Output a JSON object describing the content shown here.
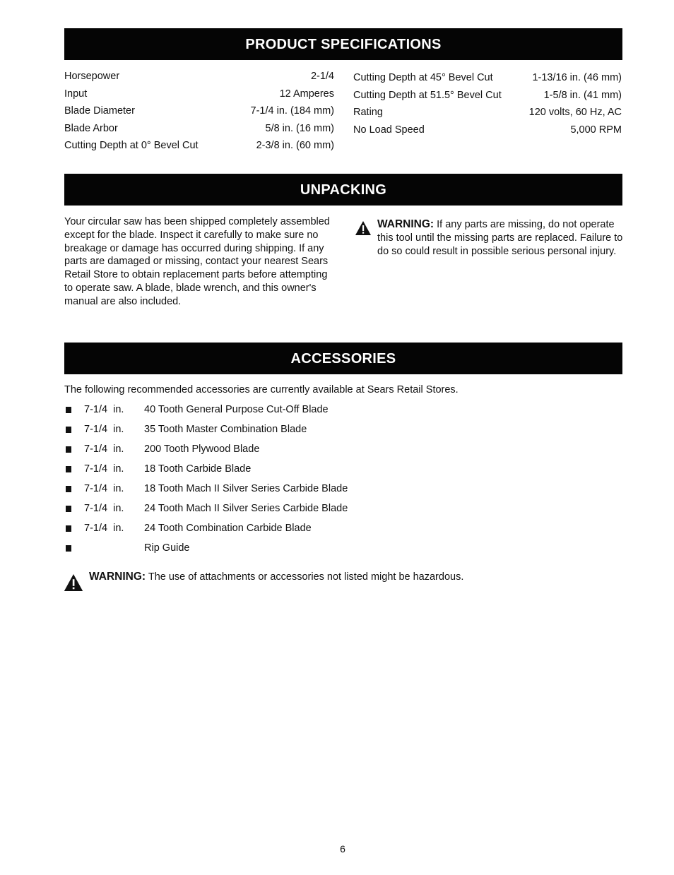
{
  "sections": {
    "specs_title": "PRODUCT SPECIFICATIONS",
    "unpacking_title": "UNPACKING",
    "accessories_title": "ACCESSORIES"
  },
  "specs": {
    "left": [
      {
        "label": "Horsepower",
        "value": "2-1/4"
      },
      {
        "label": "Input",
        "value": "12 Amperes"
      },
      {
        "label": "Blade Diameter",
        "value": "7-1/4  in. (184 mm)"
      },
      {
        "label": "Blade Arbor",
        "value": "5/8 in. (16 mm)"
      },
      {
        "label": "Cutting Depth at 0° Bevel Cut",
        "value": "2-3/8 in. (60 mm)"
      }
    ],
    "right": [
      {
        "label": "Cutting Depth at 45° Bevel Cut",
        "value": "1-13/16 in. (46 mm)"
      },
      {
        "label": "Cutting Depth at 51.5° Bevel Cut",
        "value": "1-5/8 in. (41 mm)"
      },
      {
        "label": "Rating",
        "value": "120 volts, 60 Hz, AC"
      },
      {
        "label": "No Load Speed",
        "value": "5,000 RPM"
      }
    ]
  },
  "unpacking": {
    "text": "Your circular saw has been shipped completely assembled except for the blade. Inspect it carefully to make sure no breakage or damage has occurred during shipping. If any parts are damaged or missing, contact your nearest Sears Retail Store to obtain replacement parts before attempting to operate saw. A blade, blade wrench, and this owner's manual are also included.",
    "warning_label": "WARNING:",
    "warning_text": " If any parts are missing, do not operate this tool until the missing parts are replaced. Failure to do so could result in possible serious personal injury."
  },
  "accessories": {
    "intro": "The following recommended accessories are currently available at Sears Retail Stores.",
    "items": [
      {
        "size": "7-1/4  in.",
        "name": "40 Tooth General Purpose Cut-Off Blade"
      },
      {
        "size": "7-1/4  in.",
        "name": "35 Tooth Master Combination Blade"
      },
      {
        "size": "7-1/4  in.",
        "name": "200 Tooth Plywood Blade"
      },
      {
        "size": "7-1/4  in.",
        "name": "18 Tooth Carbide Blade"
      },
      {
        "size": "7-1/4  in.",
        "name": "18 Tooth Mach II Silver Series Carbide Blade"
      },
      {
        "size": "7-1/4  in.",
        "name": "24 Tooth Mach II Silver Series Carbide Blade"
      },
      {
        "size": "7-1/4  in.",
        "name": "24 Tooth Combination Carbide Blade"
      },
      {
        "size": "",
        "name": "Rip Guide"
      }
    ],
    "warning_label": "WARNING:",
    "warning_text": " The use of attachments or accessories not listed might be hazardous."
  },
  "icons": {
    "warning": "warning-triangle-icon",
    "bullet": "square-bullet"
  },
  "page_number": "6"
}
